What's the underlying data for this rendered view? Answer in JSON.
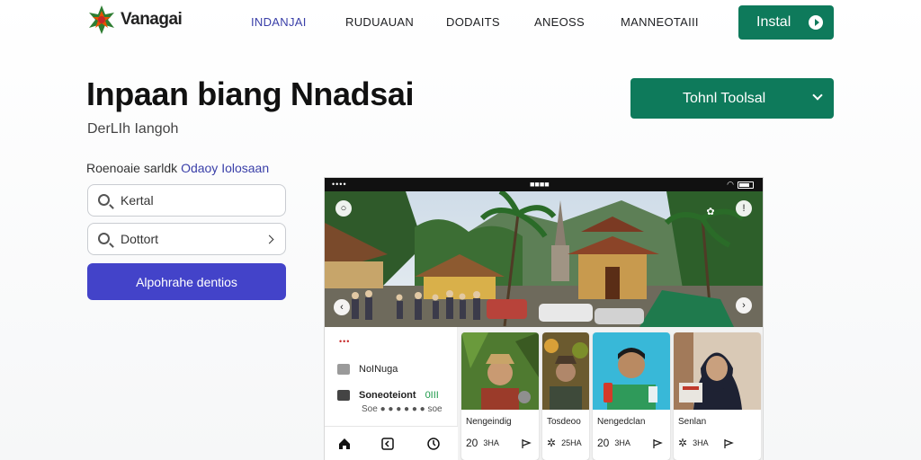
{
  "brand": {
    "name": "Vanagai"
  },
  "nav": {
    "items": [
      {
        "label": "INDANJAI",
        "active": true
      },
      {
        "label": "RUDUAUAN",
        "active": false
      },
      {
        "label": "DODAITS",
        "active": false
      },
      {
        "label": "ANEOSS",
        "active": false
      },
      {
        "label": "MANNEOTAIII",
        "active": false
      }
    ],
    "install_label": "Instal"
  },
  "hero": {
    "title": "Inpaan biang Nnadsai",
    "subtitle": "DerLIh Iangoh",
    "tool_button": "Tohnl Toolsal"
  },
  "form": {
    "helper_text": "Roenoaie sarldk",
    "helper_link": "Odaoy Iolosaan",
    "field1_value": "Kertal",
    "field2_value": "Dottort",
    "submit_label": "Alpohrahe dentios"
  },
  "phone": {
    "status_center": "■■■■",
    "side_items": [
      {
        "label": "NoINuga"
      },
      {
        "label": "Soneoteiont",
        "badge": "0III"
      }
    ],
    "side_note": "Soe ● ● ● ● ● ● soe",
    "cards": [
      {
        "name": "Nengeindig",
        "count": "20",
        "unit": "3HA",
        "icon": "person-in-forest-photo"
      },
      {
        "name": "Tosdeoo",
        "count": "",
        "unit": "25HA",
        "icon": "person-in-market-photo"
      },
      {
        "name": "Nengedclan",
        "count": "20",
        "unit": "3HA",
        "icon": "person-with-drink-photo"
      },
      {
        "name": "Senlan",
        "count": "",
        "unit": "3HA",
        "icon": "woman-in-hijab-photo"
      }
    ]
  },
  "colors": {
    "green": "#0e7a5b",
    "indigo": "#4343c9",
    "nav_active": "#3a3fa8"
  }
}
